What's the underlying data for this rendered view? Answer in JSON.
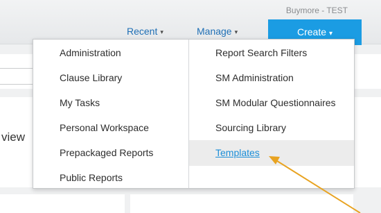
{
  "header": {
    "tenant": "Buymore - TEST",
    "nav": [
      {
        "label": "Recent",
        "caret": "▾"
      },
      {
        "label": "Manage",
        "caret": "▾"
      }
    ],
    "create": {
      "label": "Create",
      "caret": "▾"
    }
  },
  "background": {
    "partial_heading": "view"
  },
  "menu": {
    "left": [
      {
        "label": "Administration"
      },
      {
        "label": "Clause Library"
      },
      {
        "label": "My Tasks"
      },
      {
        "label": "Personal Workspace"
      },
      {
        "label": "Prepackaged Reports"
      },
      {
        "label": "Public Reports"
      }
    ],
    "right": [
      {
        "label": "Report Search Filters"
      },
      {
        "label": "SM Administration"
      },
      {
        "label": "SM Modular Questionnaires"
      },
      {
        "label": "Sourcing Library"
      },
      {
        "label": "Templates"
      }
    ],
    "highlighted": "Templates"
  },
  "annotation": {
    "arrow_color": "#e8a321"
  }
}
